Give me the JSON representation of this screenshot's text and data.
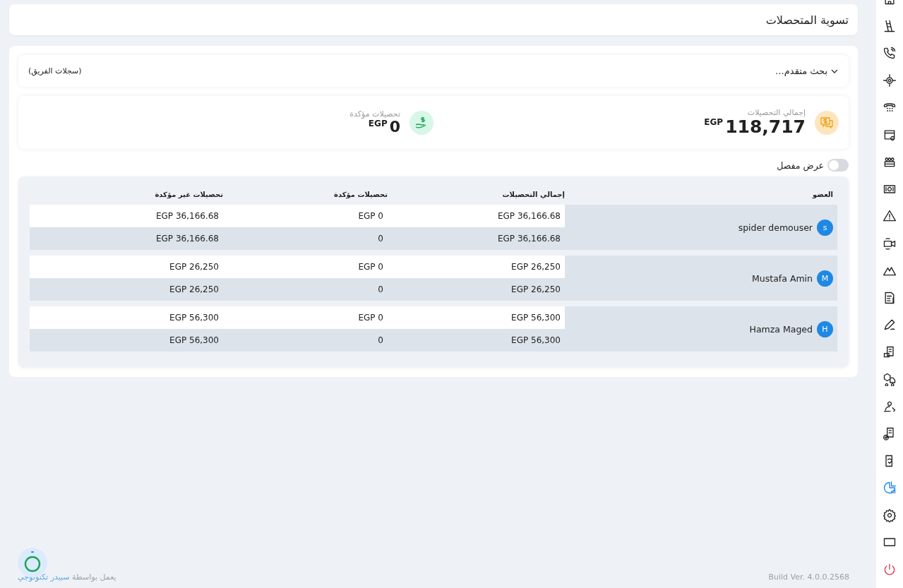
{
  "page_title": "تسوية المتحصلات",
  "advanced_search": {
    "label": "بحث متقدم...",
    "expanded": false,
    "scope": "(سجلات الفريق)"
  },
  "stats": [
    {
      "kind": "total",
      "label": "إجمالي التحصيلات",
      "value": "118,717",
      "currency": "EGP"
    },
    {
      "kind": "confirmed",
      "label": "تحصيلات مؤكدة",
      "value": "0",
      "currency": "EGP"
    }
  ],
  "detailed_view": {
    "label": "عرض مفصل",
    "on": false
  },
  "table": {
    "columns": [
      "العضو",
      "إجمالي التحصيلات",
      "تحصيلات مؤكدة",
      "تحصيلات غير مؤكدة"
    ],
    "rows": [
      {
        "initial": "s",
        "name": "spider demouser",
        "lines": [
          [
            "EGP 36,166.68",
            "EGP 0",
            "EGP 36,166.68"
          ],
          [
            "EGP 36,166.68",
            "0",
            "EGP 36,166.68"
          ]
        ]
      },
      {
        "initial": "M",
        "name": "Mustafa Amin",
        "lines": [
          [
            "EGP 26,250",
            "EGP 0",
            "EGP 26,250"
          ],
          [
            "EGP 26,250",
            "0",
            "EGP 26,250"
          ]
        ]
      },
      {
        "initial": "H",
        "name": "Hamza Maged",
        "lines": [
          [
            "EGP 56,300",
            "EGP 0",
            "EGP 56,300"
          ],
          [
            "EGP 56,300",
            "0",
            "EGP 56,300"
          ]
        ]
      }
    ]
  },
  "footer": {
    "powered_by": "يعمل بواسطة",
    "company": "سبيدر تكنولوجي",
    "build": "Build Ver. 4.0.0.2568"
  },
  "sidebar": {
    "items": [
      {
        "selected": false
      },
      {
        "selected": false
      },
      {
        "selected": false
      },
      {
        "selected": false
      },
      {
        "selected": false
      },
      {
        "selected": false
      },
      {
        "selected": false
      },
      {
        "selected": false
      },
      {
        "selected": false
      },
      {
        "selected": false
      },
      {
        "selected": false
      },
      {
        "selected": false
      },
      {
        "selected": false
      },
      {
        "selected": false
      },
      {
        "selected": false
      },
      {
        "selected": false
      },
      {
        "selected": false
      },
      {
        "selected": false
      },
      {
        "selected": true
      },
      {
        "selected": false
      },
      {
        "selected": false
      },
      {
        "selected": false
      }
    ]
  }
}
